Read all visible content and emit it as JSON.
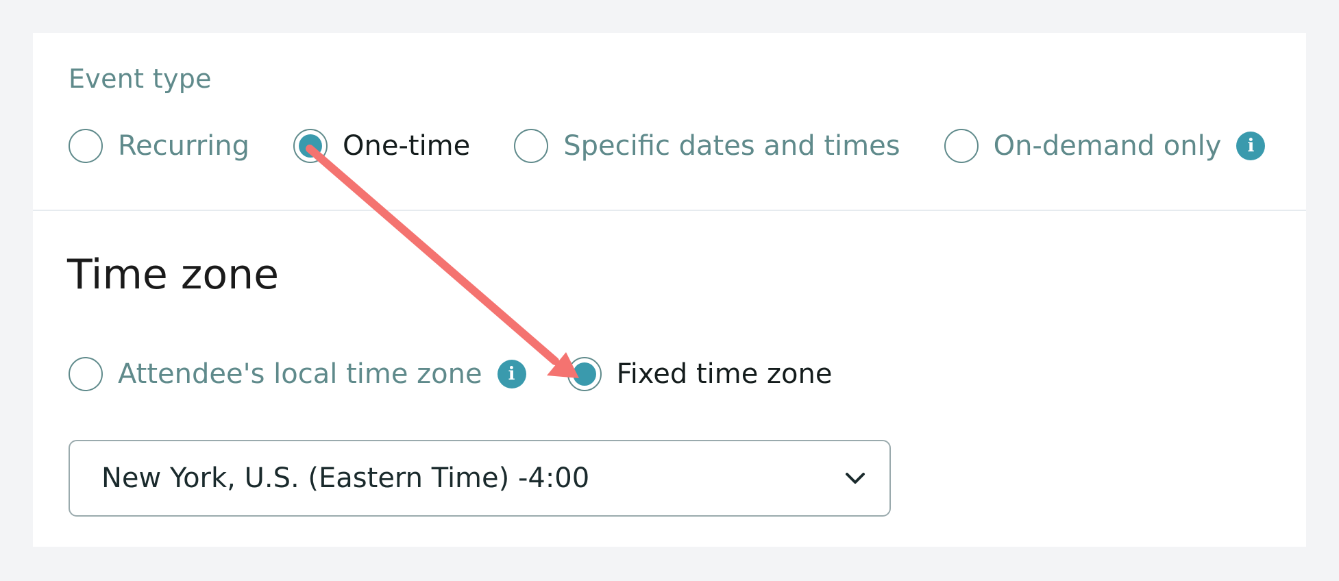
{
  "event_type": {
    "label": "Event type",
    "options": [
      {
        "label": "Recurring",
        "selected": false
      },
      {
        "label": "One-time",
        "selected": true
      },
      {
        "label": "Specific dates and times",
        "selected": false
      },
      {
        "label": "On-demand only",
        "selected": false,
        "info_icon": true
      }
    ]
  },
  "time_zone": {
    "heading": "Time zone",
    "options": [
      {
        "label": "Attendee's local time zone",
        "selected": false,
        "info_icon": true
      },
      {
        "label": "Fixed time zone",
        "selected": true
      }
    ],
    "select": {
      "value": "New York, U.S. (Eastern Time) -4:00"
    }
  },
  "icons": {
    "info": "info-icon",
    "dropdown": "chevron-down-icon",
    "annotation": "arrow-annotation"
  },
  "colors": {
    "accent": "#3a9aad",
    "muted_text": "#5f8a8b",
    "annotation_arrow": "#f47370"
  }
}
